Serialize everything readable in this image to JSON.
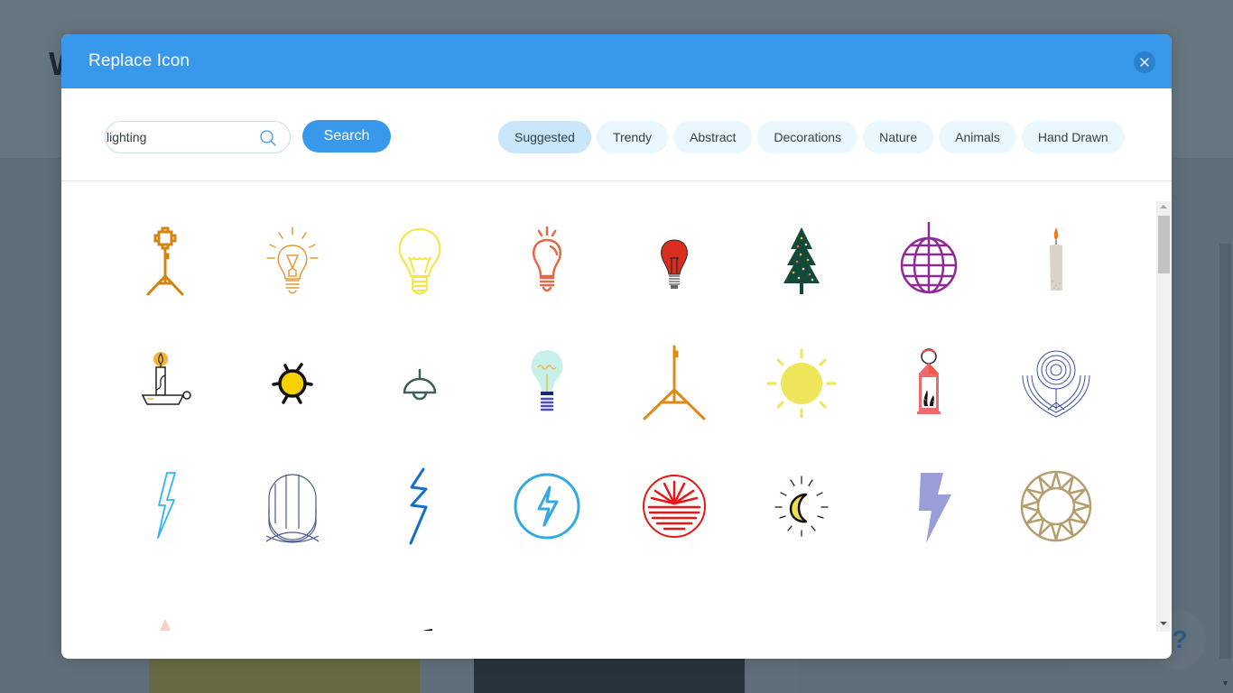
{
  "background": {
    "heading_fragment": "W",
    "help_label": "?"
  },
  "modal": {
    "title": "Replace Icon",
    "close_icon": "close-icon",
    "search": {
      "value": "lighting",
      "placeholder": "",
      "icon": "search-icon",
      "button_label": "Search"
    },
    "categories": [
      {
        "label": "Suggested",
        "active": true
      },
      {
        "label": "Trendy",
        "active": false
      },
      {
        "label": "Abstract",
        "active": false
      },
      {
        "label": "Decorations",
        "active": false
      },
      {
        "label": "Nature",
        "active": false
      },
      {
        "label": "Animals",
        "active": false
      },
      {
        "label": "Hand Drawn",
        "active": false
      }
    ],
    "icons": [
      {
        "name": "studio-light-stand-icon",
        "color": "#d3830f"
      },
      {
        "name": "light-bulb-rays-icon",
        "color": "#e39a3c"
      },
      {
        "name": "yellow-light-bulb-icon",
        "color": "#f5e63b"
      },
      {
        "name": "coral-light-bulb-icon",
        "color": "#e2694a"
      },
      {
        "name": "red-light-bulb-icon",
        "color": "#d92d20"
      },
      {
        "name": "christmas-tree-icon",
        "color": "#124a3a"
      },
      {
        "name": "disco-ball-icon",
        "color": "#8e2a93"
      },
      {
        "name": "candle-icon",
        "color": "#dbd3c7"
      },
      {
        "name": "candle-holder-icon",
        "color": "#f6b338"
      },
      {
        "name": "hand-drawn-sun-icon",
        "color": "#f8d200"
      },
      {
        "name": "pendant-lamp-icon",
        "color": "#3f5d5a"
      },
      {
        "name": "edison-bulb-icon",
        "color": "#c7f0ea"
      },
      {
        "name": "light-stand-icon",
        "color": "#dd8a16"
      },
      {
        "name": "sun-icon",
        "color": "#efe55a"
      },
      {
        "name": "lantern-icon",
        "color": "#ef6a6e"
      },
      {
        "name": "line-art-emblem-icon",
        "color": "#3c4fa3"
      },
      {
        "name": "outline-lightning-bolt-icon",
        "color": "#2cb6f2"
      },
      {
        "name": "line-arch-icon",
        "color": "#4a578f"
      },
      {
        "name": "zigzag-lightning-icon",
        "color": "#1570c3"
      },
      {
        "name": "circle-lightning-icon",
        "color": "#33a9e3"
      },
      {
        "name": "sunset-circle-icon",
        "color": "#e81616"
      },
      {
        "name": "sketched-moon-icon",
        "color": "#f0e04f"
      },
      {
        "name": "purple-lightning-icon",
        "color": "#9a9ed8"
      },
      {
        "name": "geometric-sun-icon",
        "color": "#b59e6e"
      },
      {
        "name": "boho-sun-icon",
        "color": "#a0684a"
      },
      {
        "name": "sunburst-lines-icon",
        "color": "#5a64a4"
      },
      {
        "name": "pink-lightning-sparkle-icon",
        "color": "#f6ccd8"
      },
      {
        "name": "orange-sunrise-icon",
        "color": "#f59623"
      },
      {
        "name": "two-candles-icon",
        "color": "#222222"
      },
      {
        "name": "desk-lamp-icon",
        "color": "#1a1a1a"
      },
      {
        "name": "spotlight-icon",
        "color": "#1a1a1a"
      },
      {
        "name": "rising-sun-lines-icon",
        "color": "#5a68a8"
      }
    ]
  }
}
